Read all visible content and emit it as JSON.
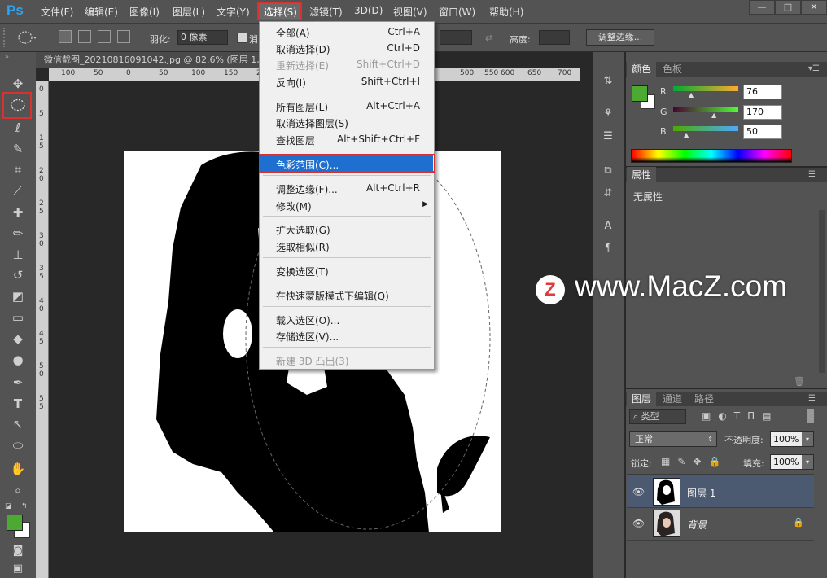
{
  "app": {
    "logo": "Ps"
  },
  "menubar": {
    "items": [
      "文件(F)",
      "编辑(E)",
      "图像(I)",
      "图层(L)",
      "文字(Y)",
      "选择(S)",
      "滤镜(T)",
      "3D(D)",
      "视图(V)",
      "窗口(W)",
      "帮助(H)"
    ]
  },
  "window_controls": {
    "minimize": "—",
    "maximize": "□",
    "close": "✕"
  },
  "options": {
    "feather_label": "羽化:",
    "feather_value": "0 像素",
    "antialias_label": "消",
    "height_label": "高度:",
    "refine_edge": "调整边缘..."
  },
  "document": {
    "tab_title": "微信截图_20210816091042.jpg @ 82.6% (图层 1,",
    "ruler_h": [
      "100",
      "50",
      "0",
      "50",
      "100",
      "150",
      "200",
      "250",
      "300",
      "350",
      "400",
      "450",
      "500",
      "550",
      "600",
      "650",
      "700"
    ],
    "ruler_v": [
      "0",
      "5",
      "1",
      "5",
      "2",
      "0",
      "2",
      "5",
      "3",
      "0",
      "3",
      "5",
      "4",
      "0",
      "4",
      "5",
      "5",
      "0",
      "5",
      "5"
    ]
  },
  "select_menu": {
    "items": [
      {
        "label": "全部(A)",
        "shortcut": "Ctrl+A",
        "disabled": false
      },
      {
        "label": "取消选择(D)",
        "shortcut": "Ctrl+D",
        "disabled": false
      },
      {
        "label": "重新选择(E)",
        "shortcut": "Shift+Ctrl+D",
        "disabled": true
      },
      {
        "label": "反向(I)",
        "shortcut": "Shift+Ctrl+I",
        "disabled": false
      },
      {
        "label": "所有图层(L)",
        "shortcut": "Alt+Ctrl+A",
        "disabled": false
      },
      {
        "label": "取消选择图层(S)",
        "shortcut": "",
        "disabled": false
      },
      {
        "label": "查找图层",
        "shortcut": "Alt+Shift+Ctrl+F",
        "disabled": false
      },
      {
        "label": "色彩范围(C)...",
        "shortcut": "",
        "disabled": false,
        "highlighted": true
      },
      {
        "label": "调整边缘(F)...",
        "shortcut": "Alt+Ctrl+R",
        "disabled": false
      },
      {
        "label": "修改(M)",
        "shortcut": "",
        "disabled": false,
        "submenu": true
      },
      {
        "label": "扩大选取(G)",
        "shortcut": "",
        "disabled": false
      },
      {
        "label": "选取相似(R)",
        "shortcut": "",
        "disabled": false
      },
      {
        "label": "变换选区(T)",
        "shortcut": "",
        "disabled": false
      },
      {
        "label": "在快速蒙版模式下编辑(Q)",
        "shortcut": "",
        "disabled": false
      },
      {
        "label": "载入选区(O)...",
        "shortcut": "",
        "disabled": false
      },
      {
        "label": "存储选区(V)...",
        "shortcut": "",
        "disabled": false
      },
      {
        "label": "新建 3D 凸出(3)",
        "shortcut": "",
        "disabled": true
      }
    ]
  },
  "color_panel": {
    "tabs": [
      "颜色",
      "色板"
    ],
    "foreground": "#4caa32",
    "background": "#ffffff",
    "r_label": "R",
    "g_label": "G",
    "b_label": "B",
    "r": "76",
    "g": "170",
    "b": "50"
  },
  "properties_panel": {
    "tab": "属性",
    "content": "无属性"
  },
  "layers_panel": {
    "tabs": [
      "图层",
      "通道",
      "路径"
    ],
    "filter_kind": "类型",
    "blend_mode": "正常",
    "opacity_label": "不透明度:",
    "opacity": "100%",
    "lock_label": "锁定:",
    "fill_label": "填充:",
    "fill": "100%",
    "layers": [
      {
        "name": "图层 1",
        "selected": true,
        "locked": false
      },
      {
        "name": "背景",
        "selected": false,
        "locked": true
      }
    ]
  },
  "watermark": {
    "logo": "Z",
    "text": "www.MacZ.com"
  },
  "colors": {
    "accent_highlight": "#1e6fd0",
    "red_outline": "#d93030",
    "ps_blue": "#2fa3f2"
  }
}
